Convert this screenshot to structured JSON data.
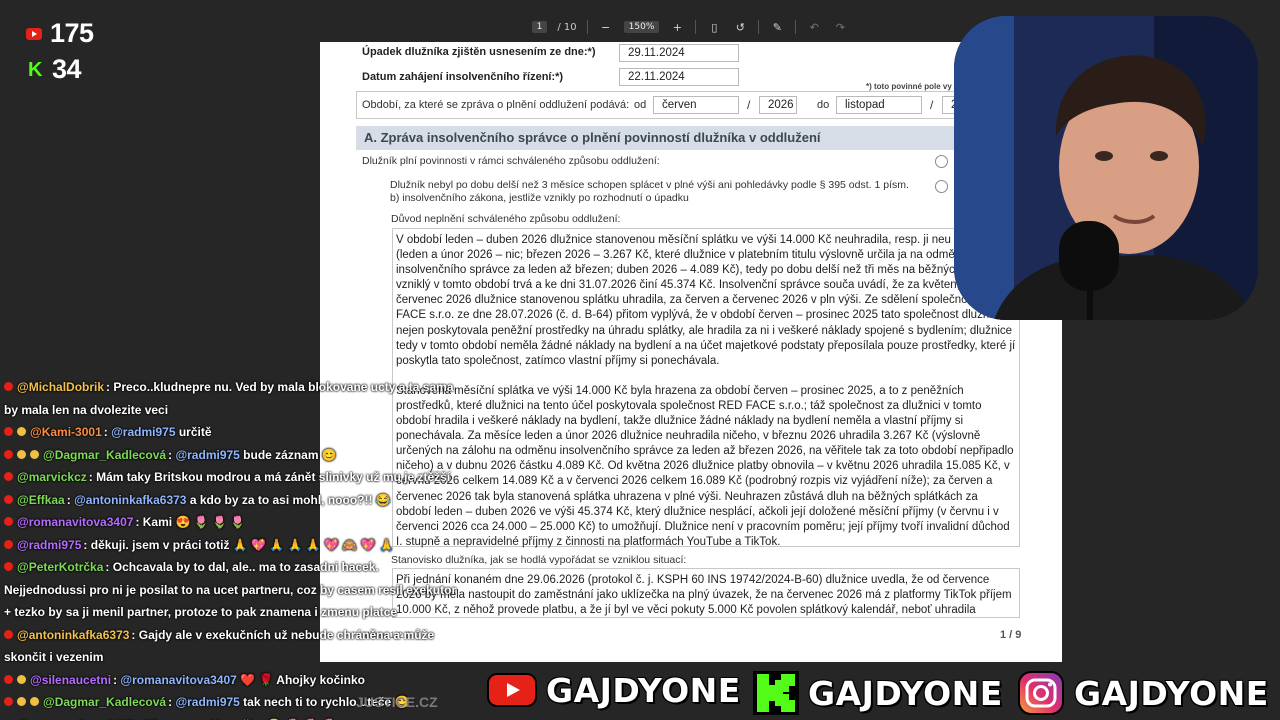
{
  "stream": {
    "youtube_viewers": "175",
    "kick_viewers": "34",
    "colors": {
      "youtube": "#e62117",
      "kick": "#53fc18",
      "background": "#262626"
    }
  },
  "pdf_toolbar": {
    "page_current": "1",
    "page_total": "/ 10",
    "zoom": "150%",
    "icons": [
      "zoom-out-icon",
      "zoom-in-icon",
      "fit-page-icon",
      "rotate-icon",
      "annotate-icon",
      "undo-icon",
      "redo-icon"
    ]
  },
  "document": {
    "row1_label": "Úpadek dlužníka zjištěn usnesením ze dne:*)",
    "row1_value": "29.11.2024",
    "row2_label": "Datum zahájení insolvenčního řízení:*)",
    "row2_value": "22.11.2024",
    "required_note": "*) toto povinné pole vy",
    "period_label": "Období, za které se zpráva o plnění oddlužení podává:",
    "period_od": "od",
    "period_from_month": "červen",
    "period_slash": "/",
    "period_from_year": "2026",
    "period_do": "do",
    "period_to_month": "listopad",
    "period_to_year": "2",
    "section_a_title": "A. Zpráva insolvenčního správce o plnění povinností dlužníka v oddlužení",
    "option1": "Dlužník plní povinnosti v rámci schváleného způsobu oddlužení:",
    "option2": "Dlužník nebyl po dobu delší než 3 měsíce schopen splácet v plné výši ani pohledávky podle § 395 odst. 1 písm. b) insolvenčního zákona, jestliže vznikly po rozhodnutí o úpadku",
    "reason_label": "Důvod neplnění schváleného způsobu oddlužení:",
    "reason_p1": "V období leden – duben 2026 dlužnice stanovenou měsíční splátku ve výši 14.000 Kč neuhradila, resp. ji neu plné výši (leden a únor 2026 – nic; březen 2026 – 3.267 Kč, které dlužnice v platebním titulu výslovně určila ja na odměnu insolvenčního správce za leden až březen; duben 2026 – 4.089 Kč), tedy po dobu delší než tři měs na běžných splátkách vzniklý v tomto období trvá a ke dni 31.07.2026 činí 45.374 Kč. Insolvenční správce souča uvádí, že za květen, červen a červenec 2026 dlužnice stanovenou splátku uhradila, za červen a červenec 2026 v pln výši. Ze sdělení společnosti RED FACE s.r.o. ze dne 28.07.2026 (č. d. B-64) přitom vyplývá, že v období červen – prosinec 2025 tato společnost dlužnici nejen poskytovala peněžní prostředky na úhradu splátky, ale hradila za ni i veškeré náklady spojené s bydlením; dlužnice tedy v tomto období neměla žádné náklady na bydlení a na účet majetkové podstaty přeposílala pouze prostředky, které jí poskytla tato společnost, zatímco vlastní příjmy si ponechávala.",
    "reason_p2": "Stanovená měsíční splátka ve výši 14.000 Kč byla hrazena za období červen – prosinec 2025, a to z peněžních prostředků, které dlužnici na tento účel poskytovala společnost RED FACE s.r.o.; táž společnost za dlužnici v tomto období hradila i veškeré náklady na bydlení, takže dlužnice žádné náklady na bydlení neměla a vlastní příjmy si ponechávala. Za měsíce leden a únor 2026 dlužnice neuhradila ničeho, v březnu 2026 uhradila 3.267 Kč (výslovně určených na zálohu na odměnu insolvenčního správce za leden až březen 2026, na věřitele tak za toto období nepřipadlo ničeho) a v dubnu 2026 částku 4.089 Kč. Od května 2026 dlužnice platby obnovila – v květnu 2026 uhradila 15.085 Kč, v červnu 2026 celkem 14.089 Kč a v červenci 2026 celkem 16.089 Kč (podrobný rozpis viz vyjádření níže); za červen a červenec 2026 tak byla stanovená splátka uhrazena v plné výši. Neuhrazen zůstává dluh na běžných splátkách za období leden – duben 2026 ve výši 45.374 Kč, který dlužnice nesplácí, ačkoli její doložené měsíční příjmy (v červnu i v červenci 2026 cca 24.000 – 25.000 Kč) to umožňují. Dlužnice není v pracovním poměru; její příjmy tvoří invalidní důchod I. stupně a nepravidelné příjmy z činnosti na platformách YouTube a TikTok.",
    "debtor_label": "Stanovisko dlužníka, jak se hodlá vypořádat se vzniklou situací:",
    "debtor_text": "Při jednání konaném dne 29.06.2026 (protokol č. j. KSPH 60 INS 19742/2024-B-60) dlužnice uvedla, že od července 2026 by měla nastoupit do zaměstnání jako uklízečka na plný úvazek, že na červenec 2026 má z platformy TikTok příjem 10.000 Kč, z něhož provede platbu, a že jí byl ve věci pokuty 5.000 Kč povolen splátkový kalendář, neboť uhradila",
    "version": "Verze  1.2.1",
    "page_indicator": "1 / 9"
  },
  "chat": [
    {
      "user": "@MichalDobrik",
      "user_color": "#f2c14e",
      "text": ": Preco..kludnepre nu. Ved by mala blokovane ucty a ta sama by mala len na dvolezite veci",
      "badges": 1
    },
    {
      "user": "@Kami-3001",
      "user_color": "#ff8c42",
      "mention": "@radmi975",
      "text": " určitě",
      "badges": 2
    },
    {
      "user": "@Dagmar_Kadlecová",
      "user_color": "#7ed957",
      "mention": "@radmi975",
      "text": " bude záznam 😊",
      "badges": 3
    },
    {
      "user": "@marvickcz",
      "user_color": "#7ed957",
      "text": ": Mám taky Britskou modrou a má zánět slinivky už mu je ztěžší",
      "badges": 1
    },
    {
      "user": "@Effkaa",
      "user_color": "#7ed957",
      "mention": "@antoninkafka6373",
      "text": " a kdo by za to asi mohl, nooo?!! 😂",
      "badges": 1
    },
    {
      "user": "@romanavitova3407",
      "user_color": "#b66cff",
      "text": ": Kami 😍 🌷 🌷 🌷",
      "badges": 1
    },
    {
      "user": "@radmi975",
      "user_color": "#b66cff",
      "text": ": děkuji. jsem v práci totiž 🙏 💖 🙏 🙏 🙏 💖 🙈 💖 🙏",
      "badges": 1
    },
    {
      "user": "@PeterKotrčka",
      "user_color": "#7ed957",
      "text": ": Ochcavala by to dal, ale.. ma to zasadni hacek. Nejjednodussi pro ni je posilat to na ucet partneru, coz by casem resil exekutor + tezko by sa ji menil partner, protoze to pak znamena i zmenu platce",
      "badges": 1
    },
    {
      "user": "@antoninkafka6373",
      "user_color": "#f2c14e",
      "text": ": Gajdy ale v exekučních už nebude chráněna a může skončit i vezenim",
      "badges": 1
    },
    {
      "user": "@silenaucetni",
      "user_color": "#b66cff",
      "mention": "@romanavitova3407",
      "text": " ❤️ 🌹 Ahojky kočinko",
      "badges": 2
    },
    {
      "user": "@Dagmar_Kadlecová",
      "user_color": "#7ed957",
      "mention": "@radmi975",
      "text": " tak nech ti to rychlo uteče 😊",
      "badges": 3
    },
    {
      "user": "@romanavitova3407",
      "user_color": "#b66cff",
      "text": ": Silenaucetni beruško 😍 🌷 🌷 🌷",
      "badges": 1
    }
  ],
  "banner": {
    "youtube_handle": "GAJDYONE",
    "kick_handle": "GAJDYONE",
    "instagram_handle": "GAJDYONE",
    "justice_logo": "JUSTICE.CZ"
  }
}
